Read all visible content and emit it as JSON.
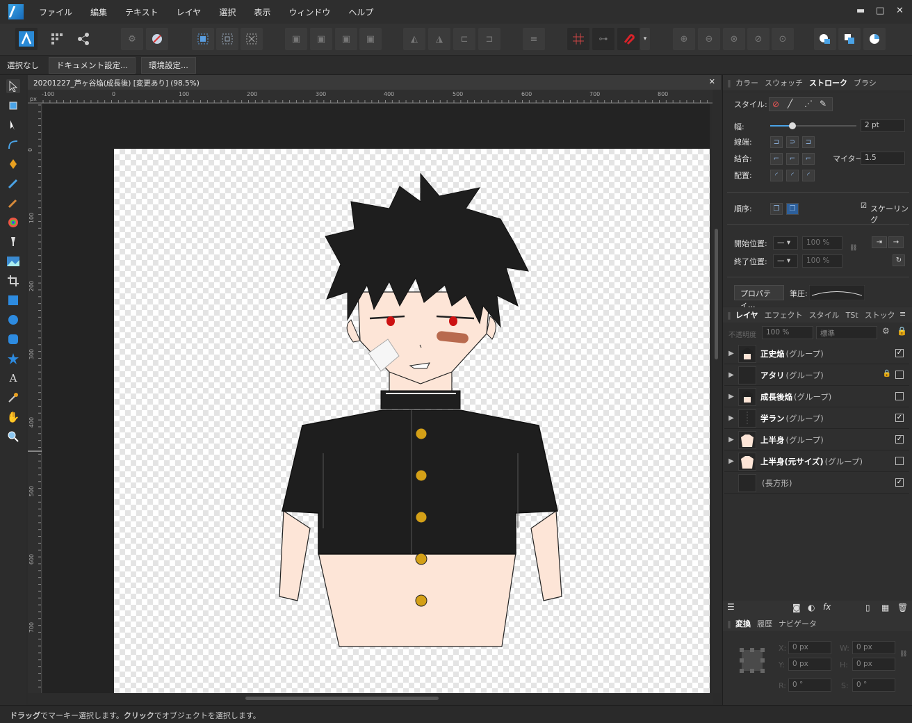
{
  "menubar": {
    "items": [
      "ファイル",
      "編集",
      "テキスト",
      "レイヤ",
      "選択",
      "表示",
      "ウィンドウ",
      "ヘルプ"
    ]
  },
  "window": {
    "minimize": "▬",
    "maximize": "□",
    "close": "✕"
  },
  "context": {
    "selection": "選択なし",
    "doc_settings": "ドキュメント設定...",
    "prefs": "環境設定..."
  },
  "document": {
    "tab_title": "20201227_芦ヶ谷焔(成長後) [変更あり] (98.5%)",
    "close": "✕",
    "ruler_unit": "px",
    "ruler_h": [
      "-100",
      "0",
      "100",
      "200",
      "300",
      "400",
      "500",
      "600",
      "700",
      "800"
    ],
    "ruler_v": [
      "0",
      "100",
      "200",
      "300",
      "400",
      "500",
      "600",
      "700"
    ]
  },
  "stroke_panel": {
    "tabs": [
      "カラー",
      "スウォッチ",
      "ストローク",
      "ブラシ"
    ],
    "active_tab": "ストローク",
    "style_label": "スタイル:",
    "width_label": "幅:",
    "width_value": "2 pt",
    "width_fraction": 0.26,
    "cap_label": "線端:",
    "join_label": "結合:",
    "miter_label": "マイター:",
    "miter_value": "1.5",
    "align_label": "配置:",
    "order_label": "順序:",
    "scaling_label": "スケーリング",
    "start_label": "開始位置:",
    "end_label": "終了位置:",
    "start_pct": "100 %",
    "end_pct": "100 %",
    "properties_btn": "プロパティ...",
    "pressure_label": "筆圧:"
  },
  "layers_panel": {
    "tabs": [
      "レイヤ",
      "エフェクト",
      "スタイル",
      "TSt",
      "ストック"
    ],
    "active_tab": "レイヤ",
    "opacity_label": "不透明度",
    "opacity_value": "100 %",
    "blend_mode": "標準",
    "layers": [
      {
        "name": "正史焔",
        "type": "(グループ)",
        "visible": true,
        "locked": false
      },
      {
        "name": "アタリ",
        "type": "(グループ)",
        "visible": false,
        "locked": true
      },
      {
        "name": "成長後焔",
        "type": "(グループ)",
        "visible": false,
        "locked": false
      },
      {
        "name": "学ラン",
        "type": "(グループ)",
        "visible": true,
        "locked": false
      },
      {
        "name": "上半身",
        "type": "(グループ)",
        "visible": true,
        "locked": false
      },
      {
        "name": "上半身(元サイズ)",
        "type": "(グループ)",
        "visible": false,
        "locked": false
      },
      {
        "name": "",
        "type": "(長方形)",
        "visible": true,
        "locked": false
      }
    ]
  },
  "transform_panel": {
    "tabs": [
      "変換",
      "履歴",
      "ナビゲータ"
    ],
    "active_tab": "変換",
    "x_label": "X:",
    "y_label": "Y:",
    "w_label": "W:",
    "h_label": "H:",
    "r_label": "R:",
    "s_label": "S:",
    "x": "0 px",
    "y": "0 px",
    "w": "0 px",
    "h": "0 px",
    "r": "0 °",
    "s": "0 °"
  },
  "status": {
    "bold1": "ドラッグ",
    "text1": "でマーキー選択します。",
    "bold2": "クリック",
    "text2": "でオブジェクトを選択します。"
  },
  "colors": {
    "accent": "#3aa7ea",
    "button_gold": "#d4a017",
    "skin": "#fde5d7",
    "hair": "#1e1e1e",
    "eye": "#cc1111"
  }
}
